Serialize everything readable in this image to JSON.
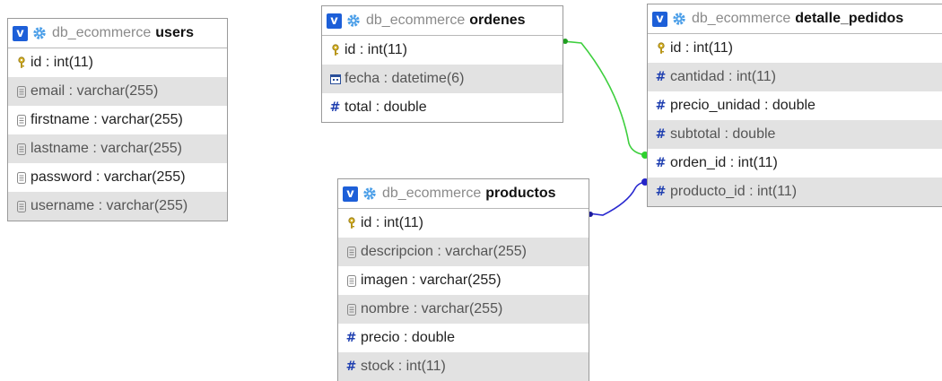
{
  "diagram": {
    "tables": [
      {
        "key": "users",
        "db": "db_ecommerce",
        "name": "users",
        "columns": [
          {
            "label": "id",
            "type": " : int(11)",
            "icon": "key-icon"
          },
          {
            "label": "email",
            "type": " : varchar(255)",
            "icon": "text-field-icon"
          },
          {
            "label": "firstname",
            "type": " : varchar(255)",
            "icon": "text-field-icon"
          },
          {
            "label": "lastname",
            "type": " : varchar(255)",
            "icon": "text-field-icon"
          },
          {
            "label": "password",
            "type": " : varchar(255)",
            "icon": "text-field-icon"
          },
          {
            "label": "username",
            "type": " : varchar(255)",
            "icon": "text-field-icon"
          }
        ]
      },
      {
        "key": "ordenes",
        "db": "db_ecommerce",
        "name": "ordenes",
        "columns": [
          {
            "label": "id",
            "type": " : int(11)",
            "icon": "key-icon"
          },
          {
            "label": "fecha",
            "type": " : datetime(6)",
            "icon": "calendar-icon"
          },
          {
            "label": "total",
            "type": " : double",
            "icon": "hash-icon"
          }
        ]
      },
      {
        "key": "detalle_pedidos",
        "db": "db_ecommerce",
        "name": "detalle_pedidos",
        "columns": [
          {
            "label": "id",
            "type": " : int(11)",
            "icon": "key-icon"
          },
          {
            "label": "cantidad",
            "type": " : int(11)",
            "icon": "hash-icon"
          },
          {
            "label": "precio_unidad",
            "type": " : double",
            "icon": "hash-icon"
          },
          {
            "label": "subtotal",
            "type": " : double",
            "icon": "hash-icon"
          },
          {
            "label": "orden_id",
            "type": " : int(11)",
            "icon": "hash-icon"
          },
          {
            "label": "producto_id",
            "type": " : int(11)",
            "icon": "hash-icon"
          }
        ]
      },
      {
        "key": "productos",
        "db": "db_ecommerce",
        "name": "productos",
        "columns": [
          {
            "label": "id",
            "type": " : int(11)",
            "icon": "key-icon"
          },
          {
            "label": "descripcion",
            "type": " : varchar(255)",
            "icon": "text-field-icon"
          },
          {
            "label": "imagen",
            "type": " : varchar(255)",
            "icon": "text-field-icon"
          },
          {
            "label": "nombre",
            "type": " : varchar(255)",
            "icon": "text-field-icon"
          },
          {
            "label": "precio",
            "type": " : double",
            "icon": "hash-icon"
          },
          {
            "label": "stock",
            "type": " : int(11)",
            "icon": "hash-icon"
          }
        ]
      }
    ],
    "relations": [
      {
        "from": "ordenes.id",
        "to": "detalle_pedidos.orden_id",
        "color": "#3ecf3e"
      },
      {
        "from": "productos.id",
        "to": "detalle_pedidos.producto_id",
        "color": "#2a2ad0"
      }
    ]
  }
}
